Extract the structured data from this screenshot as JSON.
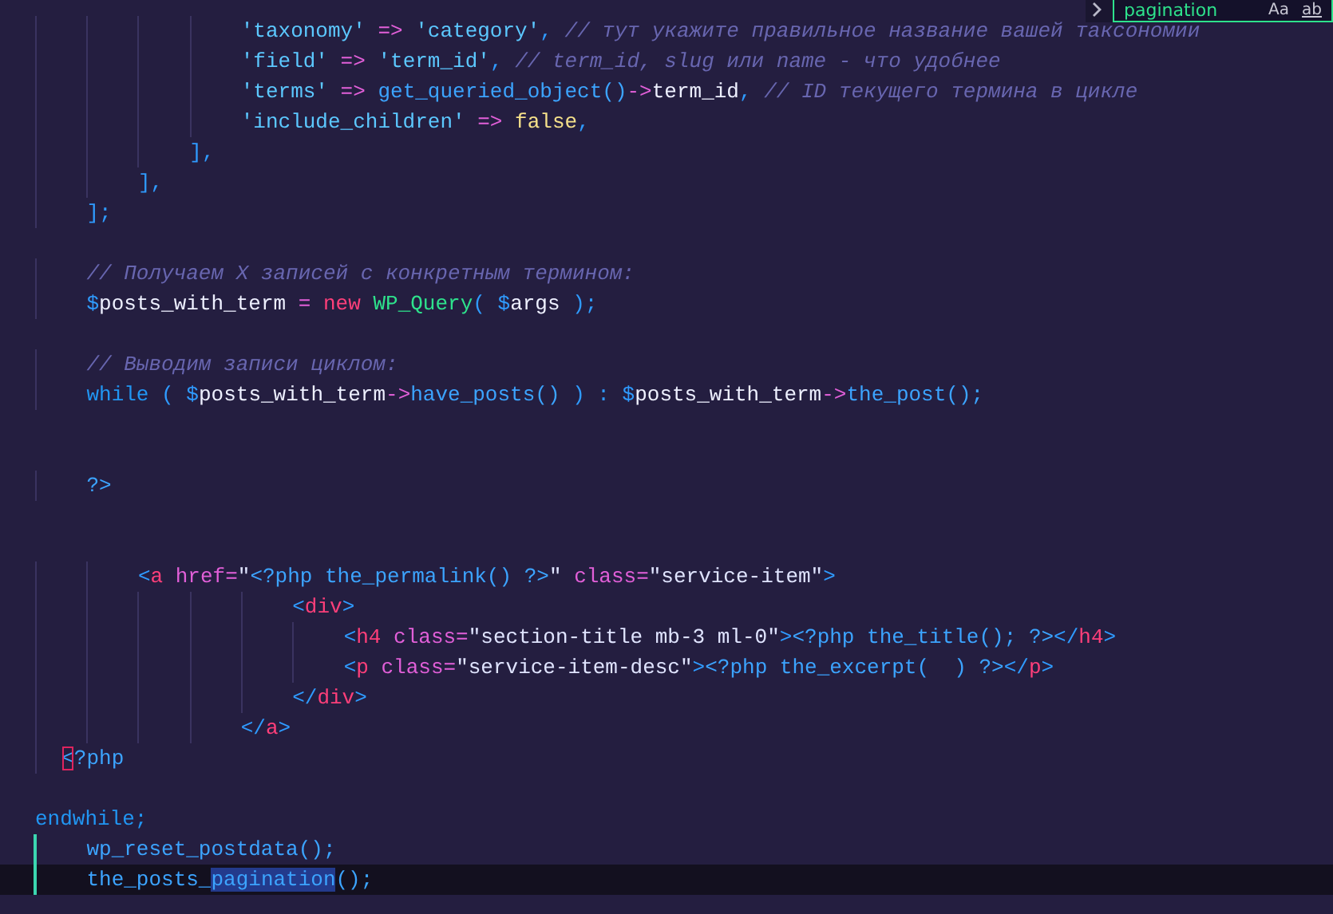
{
  "find_widget": {
    "query": "pagination",
    "match_case": "Aa",
    "whole_word": "ab"
  },
  "editor": {
    "lines": [
      {
        "current": false,
        "modified": false,
        "tokens": [
          {
            "kind": "str",
            "text": "                'taxonomy'"
          },
          {
            "kind": "op",
            "text": " =>"
          },
          {
            "kind": "str",
            "text": " 'category'"
          },
          {
            "kind": "punc",
            "text": ","
          },
          {
            "kind": "cm",
            "text": " // тут укажите правильное название вашей таксономии"
          }
        ]
      },
      {
        "current": false,
        "modified": false,
        "tokens": [
          {
            "kind": "str",
            "text": "                'field'"
          },
          {
            "kind": "op",
            "text": " =>"
          },
          {
            "kind": "str",
            "text": " 'term_id'"
          },
          {
            "kind": "punc",
            "text": ","
          },
          {
            "kind": "cm",
            "text": " // term_id, slug или name - что удобнее"
          }
        ]
      },
      {
        "current": false,
        "modified": false,
        "tokens": [
          {
            "kind": "str",
            "text": "                'terms'"
          },
          {
            "kind": "op",
            "text": " =>"
          },
          {
            "kind": "fn",
            "text": " get_queried_object()"
          },
          {
            "kind": "op",
            "text": "->"
          },
          {
            "kind": "pl",
            "text": "term_id"
          },
          {
            "kind": "punc",
            "text": ","
          },
          {
            "kind": "cm",
            "text": " // ID текущего термина в цикле"
          }
        ]
      },
      {
        "current": false,
        "modified": false,
        "tokens": [
          {
            "kind": "str",
            "text": "                'include_children'"
          },
          {
            "kind": "op",
            "text": " =>"
          },
          {
            "kind": "lit",
            "text": " false"
          },
          {
            "kind": "punc",
            "text": ","
          }
        ]
      },
      {
        "current": false,
        "modified": false,
        "tokens": [
          {
            "kind": "punc",
            "text": "            ],"
          }
        ]
      },
      {
        "current": false,
        "modified": false,
        "tokens": [
          {
            "kind": "punc",
            "text": "        ],"
          }
        ]
      },
      {
        "current": false,
        "modified": false,
        "tokens": [
          {
            "kind": "punc",
            "text": "    ];"
          }
        ]
      },
      {
        "current": false,
        "modified": false
      },
      {
        "current": false,
        "modified": false,
        "tokens": [
          {
            "kind": "cm",
            "text": "    // Получаем X записей с конкретным термином:"
          }
        ]
      },
      {
        "current": false,
        "modified": false,
        "tokens": [
          {
            "kind": "var",
            "text": "    $"
          },
          {
            "kind": "pl",
            "text": "posts_with_term"
          },
          {
            "kind": "op",
            "text": " ="
          },
          {
            "kind": "new",
            "text": " new"
          },
          {
            "kind": "cls",
            "text": " WP_Query"
          },
          {
            "kind": "punc",
            "text": "("
          },
          {
            "kind": "var",
            "text": " $"
          },
          {
            "kind": "pl",
            "text": "args"
          },
          {
            "kind": "punc",
            "text": " );"
          }
        ]
      },
      {
        "current": false,
        "modified": false
      },
      {
        "current": false,
        "modified": false,
        "tokens": [
          {
            "kind": "cm",
            "text": "    // Выводим записи циклом:"
          }
        ]
      },
      {
        "current": false,
        "modified": false,
        "tokens": [
          {
            "kind": "kw",
            "text": "    while"
          },
          {
            "kind": "punc",
            "text": " ("
          },
          {
            "kind": "var",
            "text": " $"
          },
          {
            "kind": "pl",
            "text": "posts_with_term"
          },
          {
            "kind": "op",
            "text": "->"
          },
          {
            "kind": "fn",
            "text": "have_posts()"
          },
          {
            "kind": "punc",
            "text": " ) :"
          },
          {
            "kind": "var",
            "text": " $"
          },
          {
            "kind": "pl",
            "text": "posts_with_term"
          },
          {
            "kind": "op",
            "text": "->"
          },
          {
            "kind": "fn",
            "text": "the_post();"
          }
        ]
      },
      {
        "current": false,
        "modified": false
      },
      {
        "current": false,
        "modified": false
      },
      {
        "current": false,
        "modified": false,
        "tokens": [
          {
            "kind": "php",
            "text": "    ?>"
          }
        ]
      },
      {
        "current": false,
        "modified": false
      },
      {
        "current": false,
        "modified": false
      },
      {
        "current": false,
        "modified": false,
        "tokens": [
          {
            "kind": "punc",
            "text": "        <"
          },
          {
            "kind": "tag",
            "text": "a"
          },
          {
            "kind": "attr",
            "text": " href="
          },
          {
            "kind": "aval",
            "text": "\""
          },
          {
            "kind": "php",
            "text": "<?php the_permalink() ?>"
          },
          {
            "kind": "aval",
            "text": "\""
          },
          {
            "kind": "attr",
            "text": " class="
          },
          {
            "kind": "aval",
            "text": "\"service-item\""
          },
          {
            "kind": "punc",
            "text": ">"
          }
        ]
      },
      {
        "current": false,
        "modified": false,
        "tokens": [
          {
            "kind": "punc",
            "text": "                    <"
          },
          {
            "kind": "tag",
            "text": "div"
          },
          {
            "kind": "punc",
            "text": ">"
          }
        ]
      },
      {
        "current": false,
        "modified": false,
        "tokens": [
          {
            "kind": "punc",
            "text": "                        <"
          },
          {
            "kind": "tag",
            "text": "h4"
          },
          {
            "kind": "attr",
            "text": " class="
          },
          {
            "kind": "aval",
            "text": "\"section-title mb-3 ml-0\""
          },
          {
            "kind": "punc",
            "text": ">"
          },
          {
            "kind": "php",
            "text": "<?php the_title(); ?>"
          },
          {
            "kind": "punc",
            "text": "</"
          },
          {
            "kind": "tag",
            "text": "h4"
          },
          {
            "kind": "punc",
            "text": ">"
          }
        ]
      },
      {
        "current": false,
        "modified": false,
        "tokens": [
          {
            "kind": "punc",
            "text": "                        <"
          },
          {
            "kind": "tag",
            "text": "p"
          },
          {
            "kind": "attr",
            "text": " class="
          },
          {
            "kind": "aval",
            "text": "\"service-item-desc\""
          },
          {
            "kind": "punc",
            "text": ">"
          },
          {
            "kind": "php",
            "text": "<?php the_excerpt(  ) ?>"
          },
          {
            "kind": "punc",
            "text": "</"
          },
          {
            "kind": "tag",
            "text": "p"
          },
          {
            "kind": "punc",
            "text": ">"
          }
        ]
      },
      {
        "current": false,
        "modified": false,
        "tokens": [
          {
            "kind": "punc",
            "text": "                    </"
          },
          {
            "kind": "tag",
            "text": "div"
          },
          {
            "kind": "punc",
            "text": ">"
          }
        ]
      },
      {
        "current": false,
        "modified": false,
        "tokens": [
          {
            "kind": "punc",
            "text": "                </"
          },
          {
            "kind": "tag",
            "text": "a"
          },
          {
            "kind": "punc",
            "text": ">"
          }
        ]
      },
      {
        "current": false,
        "modified": false,
        "tokens": [
          {
            "kind": "bracket",
            "text": "  <"
          },
          {
            "kind": "php",
            "text": "?php"
          }
        ]
      },
      {
        "current": false,
        "modified": false
      },
      {
        "current": false,
        "modified": false,
        "tokens": [
          {
            "kind": "kw",
            "text": "endwhile;"
          }
        ]
      },
      {
        "current": false,
        "modified": true,
        "tokens": [
          {
            "kind": "fn",
            "text": "    wp_reset_postdata();"
          }
        ]
      },
      {
        "current": true,
        "modified": true,
        "tokens": [
          {
            "kind": "fn",
            "text": "    the_posts_"
          },
          {
            "kind": "match",
            "text": "pagination"
          },
          {
            "kind": "fn",
            "text": "();"
          }
        ]
      }
    ]
  }
}
